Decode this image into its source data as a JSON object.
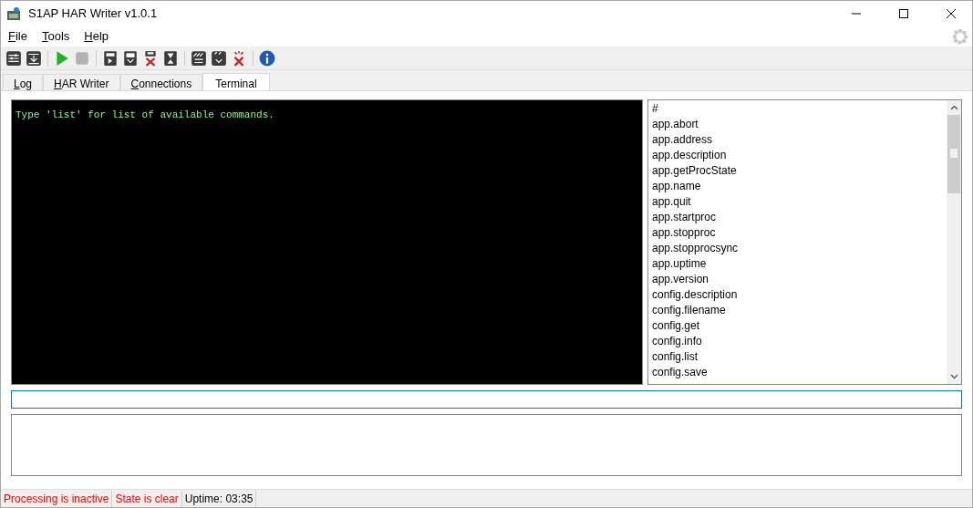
{
  "window": {
    "title": "S1AP HAR Writer v1.0.1"
  },
  "menu": [
    "File",
    "Tools",
    "Help"
  ],
  "toolbar": [
    {
      "disabled": false
    },
    {
      "disabled": false
    },
    {
      "disabled": false
    },
    {
      "disabled": true
    },
    {
      "disabled": false
    },
    {
      "disabled": false
    },
    {
      "disabled": false
    },
    {
      "disabled": false
    },
    {
      "disabled": false
    },
    {
      "disabled": false
    },
    {
      "disabled": false
    },
    {
      "disabled": false
    }
  ],
  "tabs": [
    {
      "label": "Log",
      "selected": false
    },
    {
      "label": "HAR Writer",
      "selected": false
    },
    {
      "label": "Connections",
      "selected": false
    },
    {
      "label": "Terminal",
      "selected": true
    }
  ],
  "terminal": {
    "text": "Type 'list' for list of available commands."
  },
  "commands": [
    "#",
    "app.abort",
    "app.address",
    "app.description",
    "app.getProcState",
    "app.name",
    "app.quit",
    "app.startproc",
    "app.stopproc",
    "app.stopprocsync",
    "app.uptime",
    "app.version",
    "config.description",
    "config.filename",
    "config.get",
    "config.info",
    "config.list",
    "config.save"
  ],
  "status_bar": [
    {
      "text": "Processing is inactive",
      "color": "#ff0000"
    },
    {
      "text": "State is clear",
      "color": "#ff0000"
    },
    {
      "text": "Uptime: 03:35",
      "color": "#000000"
    }
  ]
}
